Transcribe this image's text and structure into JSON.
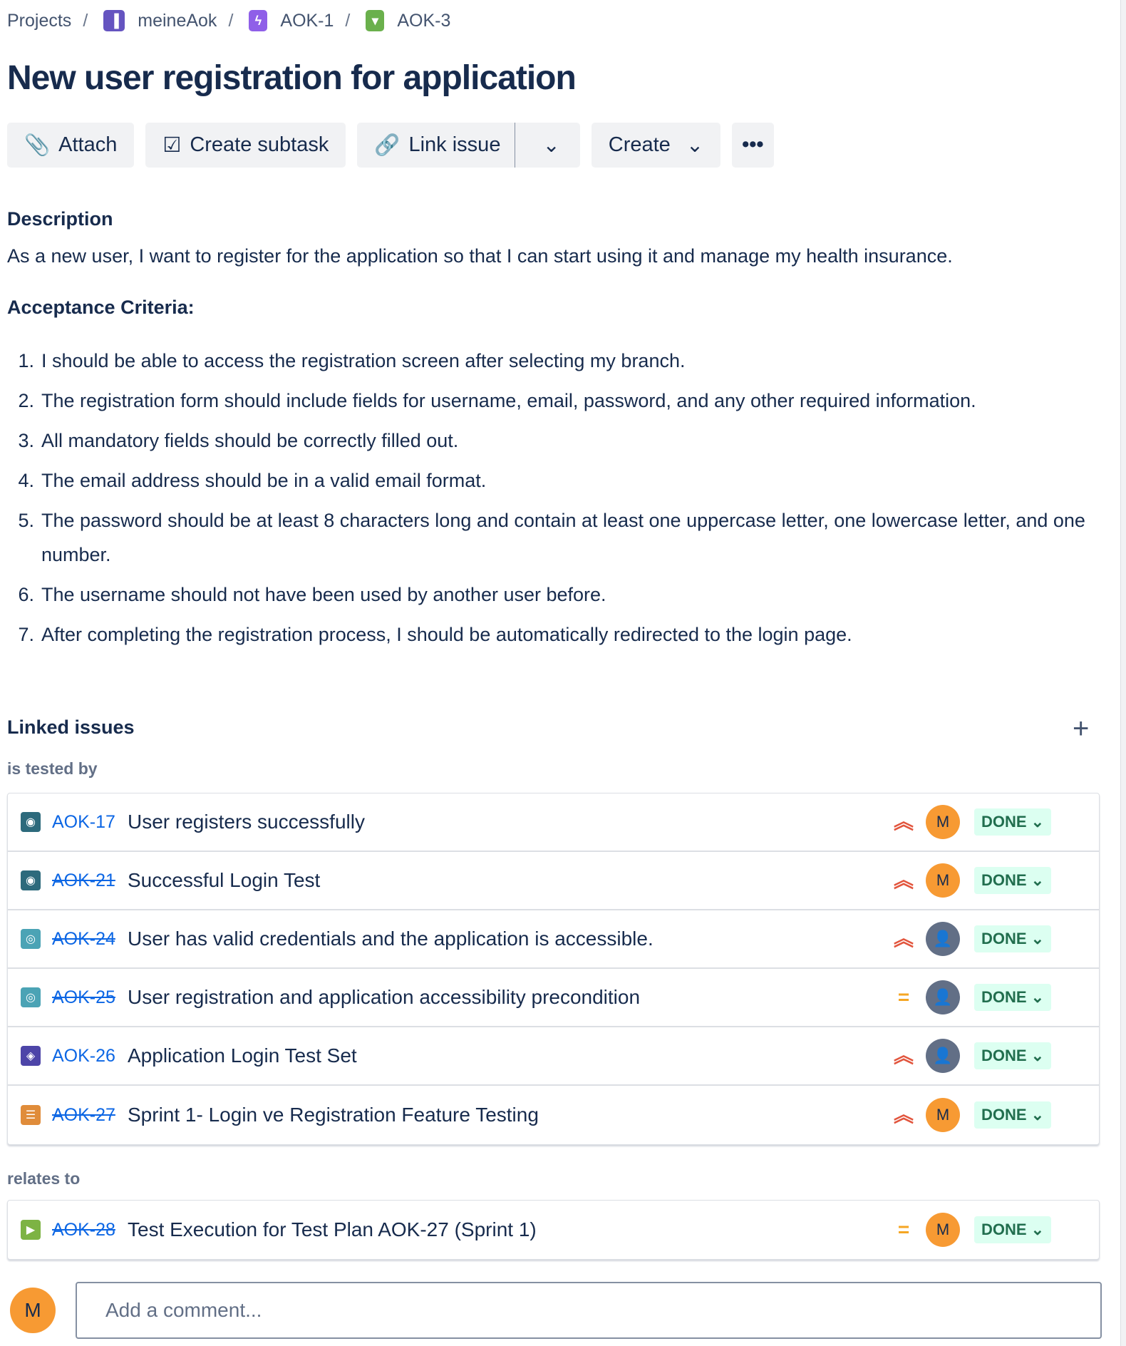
{
  "breadcrumbs": [
    "Projects",
    "meineAok",
    "AOK-1",
    "AOK-3"
  ],
  "title": "New user registration for application",
  "toolbar": {
    "attach": "Attach",
    "subtask": "Create subtask",
    "link": "Link issue",
    "create": "Create",
    "more": "•••"
  },
  "description": {
    "heading": "Description",
    "text": "As a new user, I want to register for the application so that I can start using it and manage my health insurance.",
    "criteria_heading": "Acceptance Criteria:",
    "criteria": [
      "I should be able to access the registration screen after selecting my branch.",
      "The registration form should include fields for username, email, password, and any other required information.",
      "All mandatory fields should be correctly filled out.",
      "The email address should be in a valid email format.",
      "The password should be at least 8 characters long and contain at least one uppercase letter, one lowercase letter, and one number.",
      "The username should not have been used by another user before.",
      "After completing the registration process, I should be automatically redirected to the login page."
    ]
  },
  "linked": {
    "heading": "Linked issues",
    "add": "+",
    "groups": [
      {
        "label": "is tested by",
        "issues": [
          {
            "key": "AOK-17",
            "summary": "User registers successfully",
            "resolved": false,
            "type": "test",
            "priority": "high",
            "assignee": "M",
            "status": "DONE"
          },
          {
            "key": "AOK-21",
            "summary": "Successful Login Test",
            "resolved": true,
            "type": "test",
            "priority": "high",
            "assignee": "M",
            "status": "DONE"
          },
          {
            "key": "AOK-24",
            "summary": "User has valid credentials and the application is accessible.",
            "resolved": true,
            "type": "precondition",
            "priority": "high",
            "assignee": "",
            "status": "DONE"
          },
          {
            "key": "AOK-25",
            "summary": "User registration and application accessibility precondition",
            "resolved": true,
            "type": "precondition",
            "priority": "medium",
            "assignee": "",
            "status": "DONE"
          },
          {
            "key": "AOK-26",
            "summary": "Application Login Test Set",
            "resolved": false,
            "type": "test-set",
            "priority": "high",
            "assignee": "",
            "status": "DONE"
          },
          {
            "key": "AOK-27",
            "summary": "Sprint 1- Login ve Registration Feature Testing",
            "resolved": true,
            "type": "test-plan",
            "priority": "high",
            "assignee": "M",
            "status": "DONE"
          }
        ]
      },
      {
        "label": "relates to",
        "issues": [
          {
            "key": "AOK-28",
            "summary": "Test Execution for Test Plan AOK-27 (Sprint 1)",
            "resolved": true,
            "type": "test-execution",
            "priority": "medium",
            "assignee": "M",
            "status": "DONE"
          }
        ]
      }
    ]
  },
  "comment": {
    "avatar": "M",
    "placeholder": "Add a comment..."
  },
  "colors": {
    "text": "#172b4d",
    "link": "#0c66e4",
    "done_bg": "#dcfff1",
    "done_text": "#216e4e",
    "avatar": "#f79a33"
  }
}
